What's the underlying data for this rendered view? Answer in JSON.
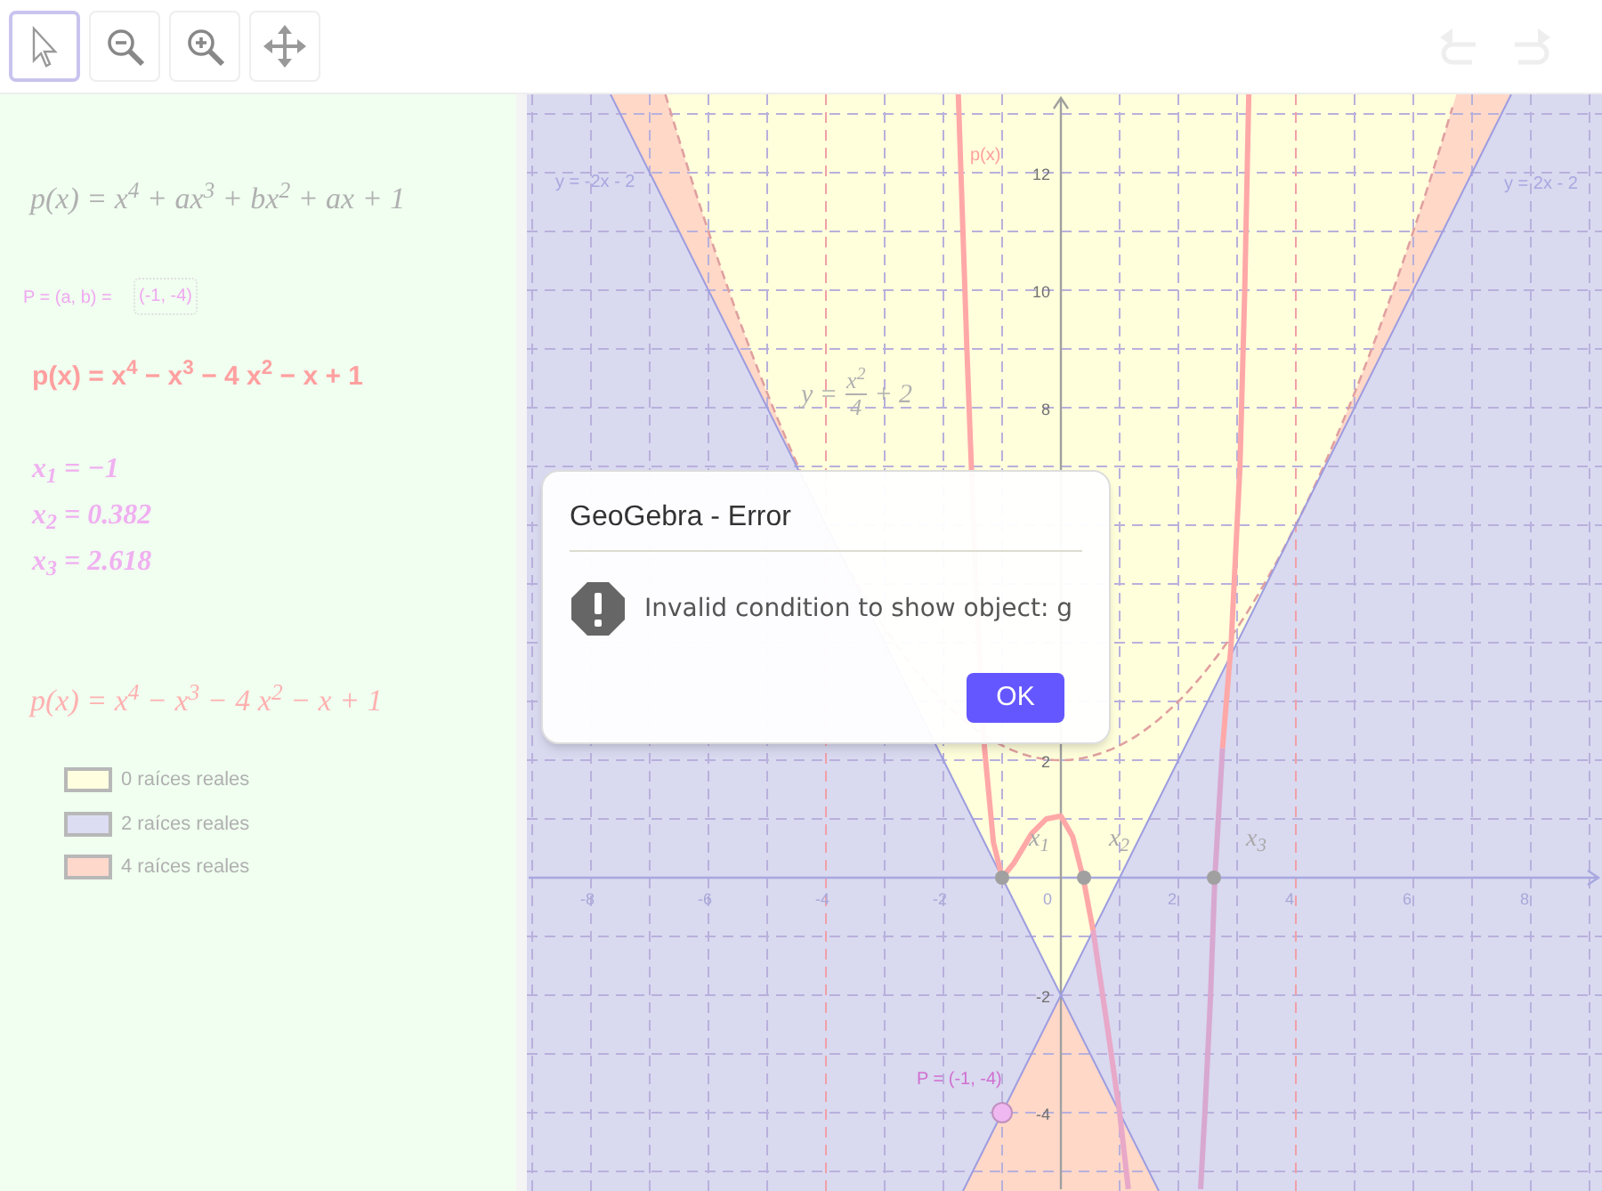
{
  "toolbar": {
    "tools": [
      {
        "kind": "pointer",
        "selected": true
      },
      {
        "kind": "zoom-out",
        "selected": false
      },
      {
        "kind": "zoom-in",
        "selected": false
      },
      {
        "kind": "move",
        "selected": false
      }
    ],
    "undo": {
      "disabled": true
    },
    "redo": {
      "disabled": true
    }
  },
  "algebra": {
    "items": [
      {
        "kind": "formula",
        "text": "p(x) = x$^{4}$ + ax$^{3}$ + bx$^{2}$ + ax + 1"
      },
      {
        "kind": "input",
        "label": "P = (a, b) =",
        "value": "(-1, -4)"
      },
      {
        "kind": "result",
        "text": "p(x) = x$^{4}$ − x$^{3}$ − 4 x$^{2}$ − x + 1"
      },
      {
        "kind": "root",
        "text": "x$_{1}$ = −1"
      },
      {
        "kind": "root",
        "text": "x$_{2}$ = 0.382"
      },
      {
        "kind": "root",
        "text": "x$_{3}$ = 2.618"
      },
      {
        "kind": "formula-pink",
        "text": "p(x) = x$^{4}$ − x$^{3}$ − 4 x$^{2}$ − x + 1"
      }
    ],
    "legend": [
      {
        "label": "0 raíces reales",
        "color": "#ffffe0"
      },
      {
        "label": "2 raíces reales",
        "color": "#dcdcf2"
      },
      {
        "label": "4 raíces reales",
        "color": "#ffd8cc"
      }
    ]
  },
  "graph": {
    "x_ticks": [
      "-8",
      "-6",
      "-4",
      "-2",
      "0",
      "2",
      "4",
      "6",
      "8"
    ],
    "y_ticks": [
      "12",
      "10",
      "8",
      "2",
      "-2",
      "-4"
    ],
    "curve_labels": [
      {
        "kind": "function",
        "text": "p(x)"
      },
      {
        "kind": "line-left",
        "text": "y = -2x - 2"
      },
      {
        "kind": "line-right",
        "text": "y = 2x - 2"
      }
    ],
    "parabola_label": {
      "lhs": "y =",
      "numerator": "x$^{2}$",
      "denominator": "4",
      "rhs": "+ 2"
    },
    "points": [
      {
        "kind": "root",
        "label": "x$_{1}$"
      },
      {
        "kind": "root",
        "label": "x$_{2}$"
      },
      {
        "kind": "root",
        "label": "x$_{3}$"
      },
      {
        "kind": "parameter",
        "label": "P = (-1, -4)"
      }
    ]
  },
  "dialog": {
    "title": "GeoGebra - Error",
    "message": "Invalid condition to show object: g",
    "button": "OK"
  }
}
